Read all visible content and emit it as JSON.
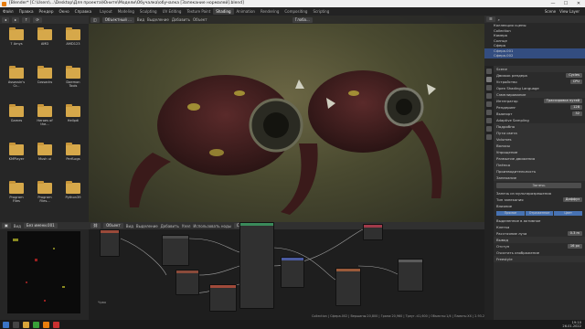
{
  "window": {
    "title": "[Blender* [C:\\Users\\...\\Desktop\\Для проекта\\Юните\\Модели\\Обучалка\\обучалка [Запекание нормалей].blend]"
  },
  "menu": [
    "Файл",
    "Правка",
    "Рендер",
    "Окно",
    "Справка"
  ],
  "workspaces": [
    "Layout",
    "Modeling",
    "Sculpting",
    "UV Editing",
    "Texture Paint",
    "Shading",
    "Animation",
    "Rendering",
    "Compositing",
    "Scripting"
  ],
  "active_workspace": "Shading",
  "scene": {
    "name": "Scene",
    "view_layer": "View Layer"
  },
  "file_browser": {
    "items": [
      {
        "label": "7 Amys"
      },
      {
        "label": "AMD"
      },
      {
        "label": "AMD123"
      },
      {
        "label": "Assassin's Cr..."
      },
      {
        "label": "Cossacks"
      },
      {
        "label": "Daemon Tools"
      },
      {
        "label": "Games"
      },
      {
        "label": "Heroes of the..."
      },
      {
        "label": "Hellpdi"
      },
      {
        "label": "KMPlayer"
      },
      {
        "label": "Mush ui"
      },
      {
        "label": "PerfLogs"
      },
      {
        "label": "Program Files"
      },
      {
        "label": "Program Files..."
      },
      {
        "label": "Python39"
      }
    ]
  },
  "viewport_header": {
    "mode": "Объектный ...",
    "menus": [
      "Вид",
      "Выделение",
      "Добавить",
      "Объект"
    ],
    "transform": "Глоба..."
  },
  "outliner": {
    "rows": [
      {
        "label": "Коллекция сцены",
        "selected": false
      },
      {
        "label": "Collection",
        "selected": false
      },
      {
        "label": "Камера",
        "selected": false
      },
      {
        "label": "Солнце",
        "selected": false
      },
      {
        "label": "Сфера",
        "selected": false
      },
      {
        "label": "Сфера.001",
        "selected": true
      },
      {
        "label": "Сфера.002",
        "selected": true
      }
    ]
  },
  "properties": {
    "scene_label": "Scene",
    "rows": [
      {
        "label": "Движок рендера",
        "value": "Cycles",
        "section": false
      },
      {
        "label": "Устройство",
        "value": "CPU",
        "section": false
      },
      {
        "label": "Open Shading Language",
        "value": "",
        "section": false
      },
      {
        "label": "Сэмплирование",
        "value": "",
        "section": true
      },
      {
        "label": "Интегратор",
        "value": "Трассировка путей",
        "section": false
      },
      {
        "label": "Рендеринг",
        "value": "128",
        "section": false
      },
      {
        "label": "Вьюпорт",
        "value": "32",
        "section": false
      },
      {
        "label": "Adaptive Sampling",
        "value": "",
        "section": false
      },
      {
        "label": "Подробно",
        "value": "",
        "section": true
      },
      {
        "label": "Пути света",
        "value": "",
        "section": true
      },
      {
        "label": "Volumes",
        "value": "",
        "section": true
      },
      {
        "label": "Волосы",
        "value": "",
        "section": true
      },
      {
        "label": "Упрощение",
        "value": "",
        "section": true
      },
      {
        "label": "Размытие движения",
        "value": "",
        "section": true
      },
      {
        "label": "Плёнка",
        "value": "",
        "section": true
      },
      {
        "label": "Производительность",
        "value": "",
        "section": true
      },
      {
        "label": "Запекание",
        "value": "",
        "section": true
      }
    ],
    "bake_button": "Запечь",
    "bake_options": [
      {
        "label": "Запечь из мультиразрешения",
        "value": ""
      },
      {
        "label": "Тип запекания",
        "value": "Диффуз"
      },
      {
        "label": "Влияние",
        "value": ""
      }
    ],
    "influence_tabs": [
      "Прямое",
      "Отраженное",
      "Цвет"
    ],
    "selected_to_active": "Выделенное в активное",
    "cage": "Клетка",
    "extrusion": {
      "label": "Расстояние луча",
      "value": "0.3 m"
    },
    "output": {
      "label": "Вывод",
      "margin_label": "Отступ",
      "margin_value": "16 px",
      "clear": "Очистить изображение"
    },
    "freestyle": "Freestyle"
  },
  "node_header": {
    "type": "Объект",
    "menus": [
      "Вид",
      "Выделение",
      "Добавить",
      "Узел"
    ],
    "use_nodes": "Использовать ноды",
    "slot": "Слот 1",
    "material": "Чрво"
  },
  "image_editor": {
    "menus": [
      "Вид",
      "Вид"
    ],
    "image_name": "Без имени.001"
  },
  "node_editor_label": "Чрво",
  "statusbar": "Collection | Сфера.002 | Вершины:20,800 | Грани:20,960 | Треуг.:41,600 | Объекты:1/4 | Память:XX | 2.93.2",
  "taskbar": {
    "clock": "19:10",
    "date": "26.01.2022"
  }
}
